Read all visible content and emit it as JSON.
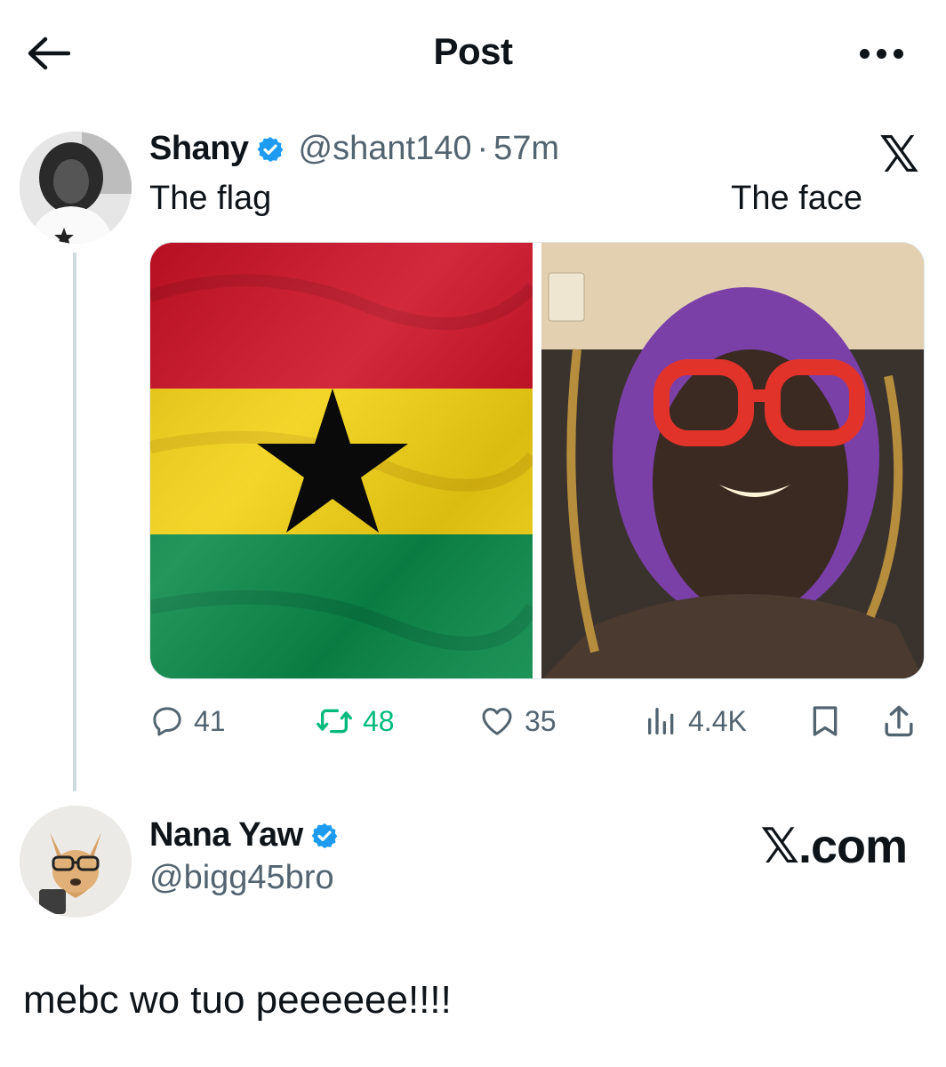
{
  "header": {
    "title": "Post"
  },
  "tweet": {
    "author": {
      "display_name": "Shany",
      "handle": "@shant140",
      "separator": "·",
      "time": "57m"
    },
    "brand_mark": "𝕏",
    "captions": {
      "left": "The flag",
      "right": "The face"
    },
    "media": [
      {
        "label": "Ghana flag",
        "colors": [
          "#ce1126",
          "#fcd116",
          "#006b3f"
        ]
      },
      {
        "label": "selfie photo"
      }
    ],
    "stats": {
      "replies": "41",
      "reposts": "48",
      "likes": "35",
      "views": "4.4K"
    }
  },
  "reply": {
    "author": {
      "display_name": "Nana Yaw",
      "handle": "@bigg45bro"
    },
    "site_label": "𝕏.com",
    "text": "mebc wo tuo peeeeee!!!!"
  },
  "colors": {
    "verified": "#1d9bf0",
    "repost_active": "#00ba7c",
    "muted": "#536471"
  }
}
